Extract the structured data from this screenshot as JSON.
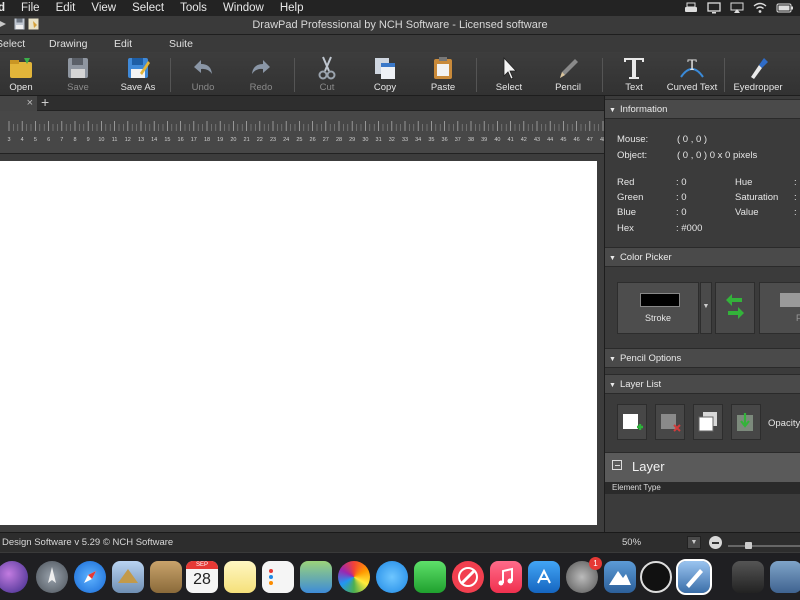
{
  "menubar": {
    "app_name": "d",
    "items": [
      "File",
      "Edit",
      "View",
      "Select",
      "Tools",
      "Window",
      "Help"
    ]
  },
  "window": {
    "title": "DrawPad Professional by NCH Software - Licensed software"
  },
  "tabs": [
    "Select",
    "Drawing",
    "Edit",
    "Suite"
  ],
  "toolbar": {
    "open": "Open",
    "save": "Save",
    "save_as": "Save As",
    "undo": "Undo",
    "redo": "Redo",
    "cut": "Cut",
    "copy": "Copy",
    "paste": "Paste",
    "select": "Select",
    "pencil": "Pencil",
    "text": "Text",
    "curved_text": "Curved Text",
    "eyedropper": "Eyedropper"
  },
  "doc_tab": {
    "close": "×",
    "add": "+"
  },
  "ruler": {
    "labels": [
      "3",
      "4",
      "5",
      "6",
      "7",
      "8",
      "9",
      "10",
      "11",
      "12",
      "13",
      "14",
      "15",
      "16",
      "17",
      "18",
      "19",
      "20",
      "21",
      "22",
      "23",
      "24",
      "25",
      "26",
      "27",
      "28",
      "29",
      "30",
      "31",
      "32",
      "33",
      "34",
      "35",
      "36",
      "37",
      "38",
      "39",
      "40",
      "41",
      "42",
      "43",
      "44",
      "45",
      "46",
      "47",
      "48"
    ]
  },
  "info_panel": {
    "header": "Information",
    "mouse_label": "Mouse:",
    "mouse_value": "( 0 , 0 )",
    "object_label": "Object:",
    "object_value": "( 0 , 0 ) 0 x 0 pixels",
    "red_label": "Red",
    "red_value": ": 0",
    "green_label": "Green",
    "green_value": ": 0",
    "blue_label": "Blue",
    "blue_value": ": 0",
    "hex_label": "Hex",
    "hex_value": ": #000",
    "hue_label": "Hue",
    "saturation_label": "Saturation",
    "value_label": "Value",
    "colon": ":"
  },
  "color_picker": {
    "header": "Color Picker",
    "stroke_label": "Stroke",
    "stroke_color": "#000000",
    "fill_label": "F"
  },
  "pencil_options": {
    "header": "Pencil Options"
  },
  "layer_list": {
    "header": "Layer List",
    "opacity_label": "Opacity",
    "layer_title": "Layer",
    "element_type_header": "Element Type"
  },
  "status": {
    "version": "Design Software v 5.29 © NCH Software",
    "zoom": "50%"
  },
  "dock": {
    "calendar_month": "SEP",
    "calendar_day": "28",
    "app_store_badge": "1"
  }
}
